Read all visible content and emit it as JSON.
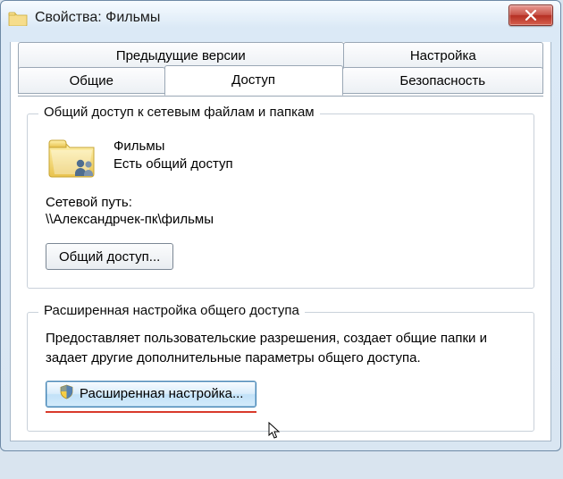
{
  "window": {
    "title": "Свойства: Фильмы"
  },
  "tabs": {
    "row1": [
      {
        "label": "Предыдущие версии"
      },
      {
        "label": "Настройка"
      }
    ],
    "row2": [
      {
        "label": "Общие"
      },
      {
        "label": "Доступ",
        "selected": true
      },
      {
        "label": "Безопасность"
      }
    ]
  },
  "share_group": {
    "title": "Общий доступ к сетевым файлам и папкам",
    "folder_name": "Фильмы",
    "status": "Есть общий доступ",
    "netpath_label": "Сетевой путь:",
    "netpath_value": "\\\\Александрчек-пк\\фильмы",
    "share_button": "Общий доступ..."
  },
  "adv_group": {
    "title": "Расширенная настройка общего доступа",
    "description": "Предоставляет пользовательские разрешения, создает общие папки и задает другие дополнительные параметры общего доступа.",
    "button": "Расширенная настройка..."
  },
  "icons": {
    "folder": "folder-icon",
    "shield": "shield-icon",
    "close": "close-icon"
  }
}
